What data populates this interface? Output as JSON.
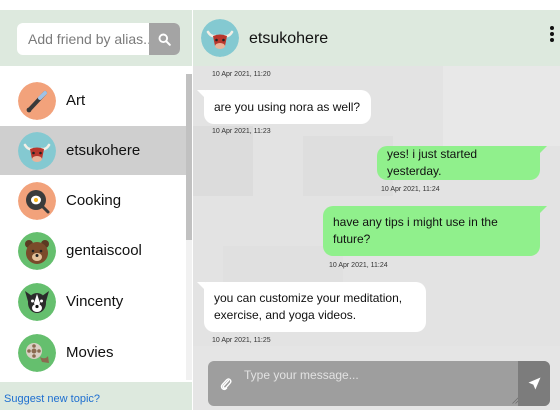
{
  "search": {
    "placeholder": "Add friend by alias..."
  },
  "friends": [
    {
      "name": "Art",
      "icon": "paintbrush-icon"
    },
    {
      "name": "etsukohere",
      "icon": "bull-icon",
      "active": true
    },
    {
      "name": "Cooking",
      "icon": "frying-pan-icon"
    },
    {
      "name": "gentaiscool",
      "icon": "bear-icon"
    },
    {
      "name": "Vincenty",
      "icon": "dog-icon"
    },
    {
      "name": "Movies",
      "icon": "film-reel-icon"
    }
  ],
  "suggest_label": "Suggest new topic?",
  "chat": {
    "title": "etsukohere",
    "messages": [
      {
        "stamp": "10 Apr 2021, 11:20"
      },
      {
        "direction": "in",
        "text": "are you using nora as well?",
        "stamp": "10 Apr 2021, 11:23"
      },
      {
        "direction": "out",
        "text": "yes! i just started yesterday.",
        "stamp": "10 Apr 2021, 11:24"
      },
      {
        "direction": "out",
        "text": "have any tips i might use in the future?",
        "stamp": "10 Apr 2021, 11:24"
      },
      {
        "direction": "in",
        "text": "you can customize your meditation, exercise, and yoga videos.",
        "stamp": "10 Apr 2021, 11:25"
      }
    ]
  },
  "composer": {
    "placeholder": "Type your message..."
  },
  "colors": {
    "header_bg": "#dde9de",
    "outgoing_bubble": "#90f08c",
    "incoming_bubble": "#ffffff",
    "active_row": "#cfcfcf",
    "link": "#1e6fd0"
  }
}
